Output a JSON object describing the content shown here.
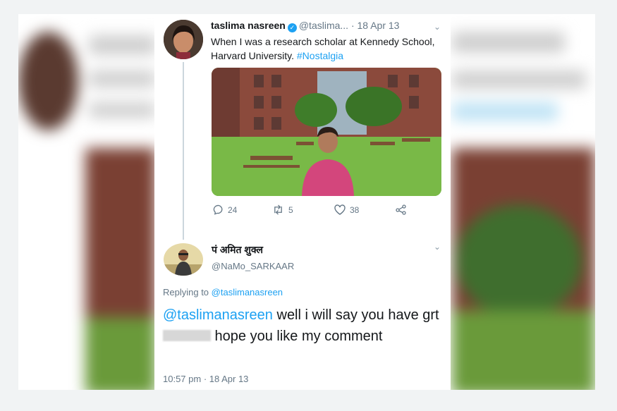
{
  "tweet": {
    "author_name": "taslima nasreen",
    "author_handle": "@taslima...",
    "date": "· 18 Apr 13",
    "text": "When I was a research scholar at Kennedy School, Harvard University.",
    "hashtag": "#Nostalgia",
    "stats": {
      "replies": "24",
      "retweets": "5",
      "likes": "38"
    }
  },
  "reply": {
    "author_name": "पं अमित शुक्ल",
    "author_handle": "@NaMo_SARKAAR",
    "replying_label": "Replying to",
    "replying_to": "@taslimanasreen",
    "mention": "@taslimanasreen",
    "text_1": " well i will say you have grt",
    "text_2": " hope you like my comment",
    "timestamp": "10:57 pm · 18 Apr 13"
  },
  "colors": {
    "link": "#1da1f2",
    "muted": "#657786",
    "text": "#14171a"
  }
}
